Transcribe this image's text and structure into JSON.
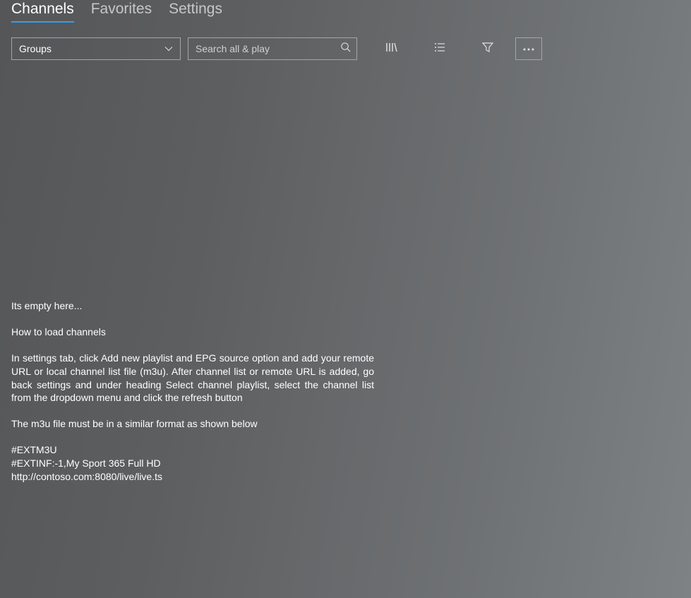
{
  "tabs": {
    "channels": "Channels",
    "favorites": "Favorites",
    "settings": "Settings"
  },
  "toolbar": {
    "dropdown_value": "Groups",
    "search_placeholder": "Search all & play"
  },
  "empty_state": {
    "title": "Its empty here...",
    "howto_heading": "How to load  channels",
    "instructions": "In settings tab, click Add new playlist and EPG source  option and add your remote URL or local channel list file (m3u). After channel list or remote URL is added, go back settings and under heading  Select channel playlist, select the channel list from the dropdown menu and click the refresh button",
    "format_note": "The m3u file must be in a similar format as shown below",
    "example_line1": "#EXTM3U",
    "example_line2": "#EXTINF:-1,My Sport 365 Full HD",
    "example_line3": "http://contoso.com:8080/live/live.ts"
  }
}
